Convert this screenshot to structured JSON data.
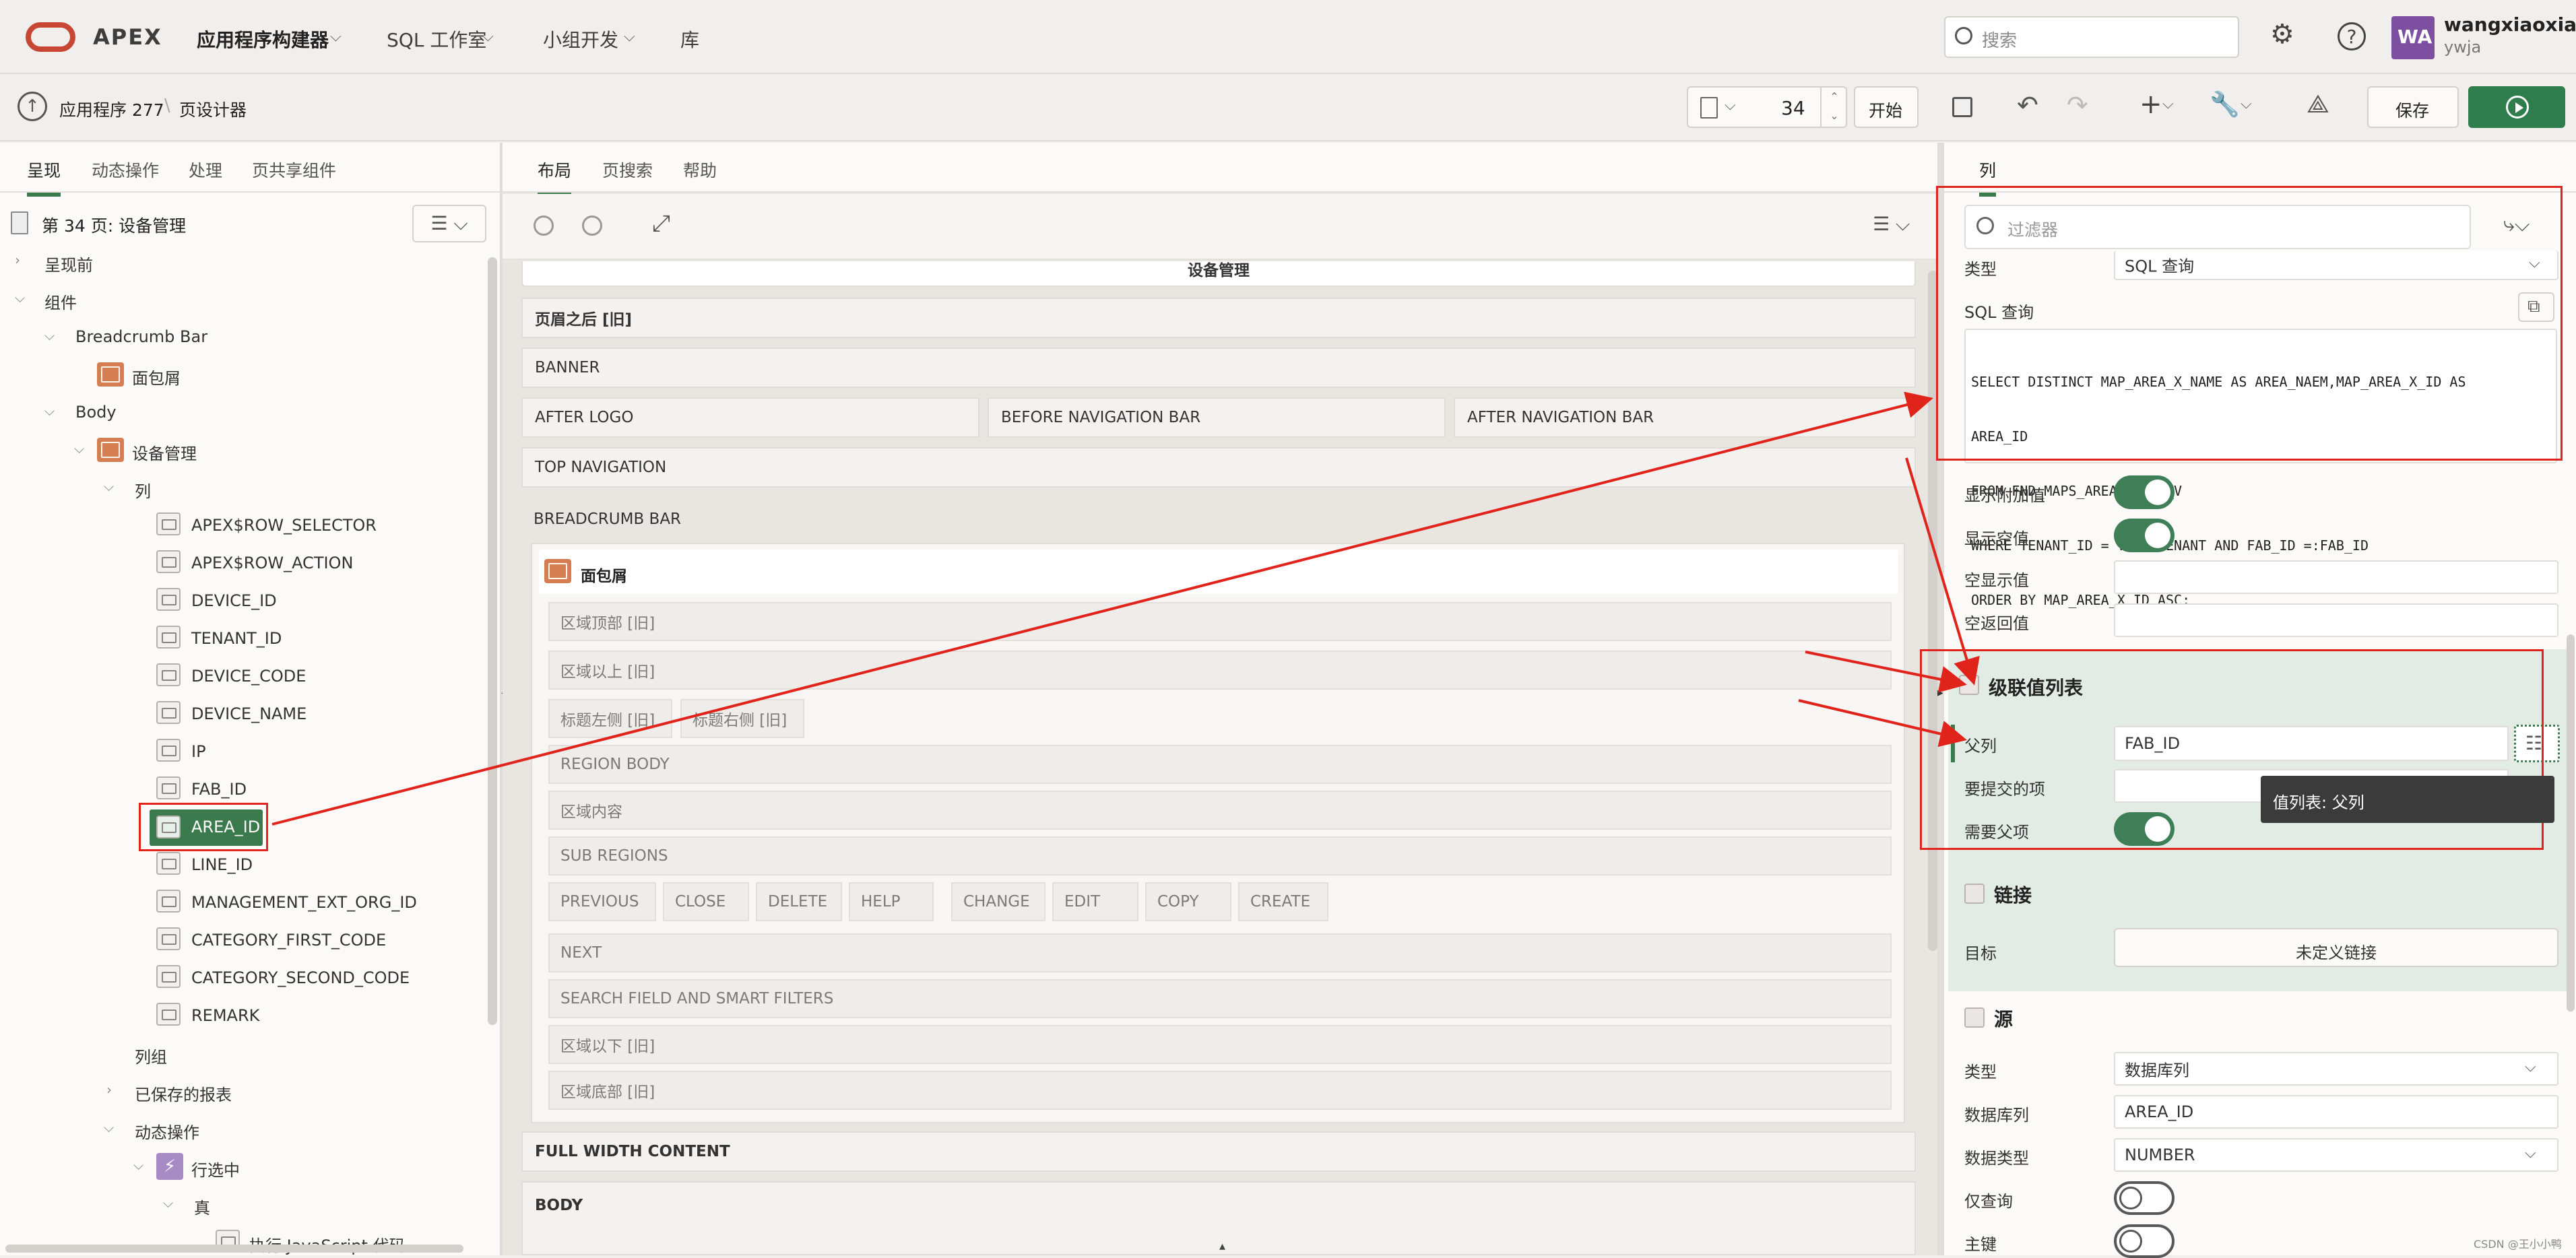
{
  "topbar": {
    "logo_text": "APEX",
    "nav": [
      "应用程序构建器",
      "SQL 工作室",
      "小组开发",
      "库"
    ],
    "search_placeholder": "搜索",
    "avatar_initials": "WA",
    "user_name": "wangxiaoxian",
    "user_workspace": "ywja"
  },
  "toolbar": {
    "breadcrumb": [
      "应用程序 277",
      "页设计器"
    ],
    "page_number": "34",
    "start_label": "开始",
    "save_label": "保存"
  },
  "left_panel": {
    "tabs": [
      "呈现",
      "动态操作",
      "处理",
      "页共享组件"
    ],
    "page_title": "第 34 页: 设备管理",
    "tree": {
      "before_header": "呈现前",
      "components": "组件",
      "breadcrumb_bar": "Breadcrumb Bar",
      "breadcrumb_region": "面包屑",
      "body": "Body",
      "region": "设备管理",
      "columns": "列",
      "column_items": [
        "APEX$ROW_SELECTOR",
        "APEX$ROW_ACTION",
        "DEVICE_ID",
        "TENANT_ID",
        "DEVICE_CODE",
        "DEVICE_NAME",
        "IP",
        "FAB_ID",
        "AREA_ID",
        "LINE_ID",
        "MANAGEMENT_EXT_ORG_ID",
        "CATEGORY_FIRST_CODE",
        "CATEGORY_SECOND_CODE",
        "REMARK"
      ],
      "column_groups": "列组",
      "saved_reports": "已保存的报表",
      "dynamic_actions": "动态操作",
      "da_event": "行选中",
      "da_true": "真",
      "da_action": "执行 JavaScript 代码"
    }
  },
  "middle_panel": {
    "tabs": [
      "布局",
      "页搜索",
      "帮助"
    ],
    "layout": {
      "top_title": "设备管理",
      "after_header": "页眉之后 [旧]",
      "banner": "BANNER",
      "after_logo": "AFTER LOGO",
      "before_nav_bar": "BEFORE NAVIGATION BAR",
      "after_nav_bar": "AFTER NAVIGATION BAR",
      "top_navigation": "TOP NAVIGATION",
      "breadcrumb_bar": "BREADCRUMB BAR",
      "breadcrumb_region": "面包屑",
      "region_top": "区域顶部 [旧]",
      "above_region": "区域以上 [旧]",
      "title_left": "标题左侧 [旧]",
      "title_right": "标题右侧 [旧]",
      "region_body": "REGION BODY",
      "region_content": "区域内容",
      "sub_regions": "SUB REGIONS",
      "buttons": [
        "PREVIOUS",
        "CLOSE",
        "DELETE",
        "HELP",
        "CHANGE",
        "EDIT",
        "COPY",
        "CREATE"
      ],
      "next": "NEXT",
      "search_field": "SEARCH FIELD AND SMART FILTERS",
      "below_region": "区域以下 [旧]",
      "region_bottom": "区域底部 [旧]",
      "full_width": "FULL WIDTH CONTENT",
      "body": "BODY"
    }
  },
  "right_panel": {
    "tab": "列",
    "filter_placeholder": "过滤器",
    "type_label": "类型",
    "type_value": "SQL 查询",
    "sql_label": "SQL 查询",
    "sql_lines": [
      "SELECT DISTINCT MAP_AREA_X_NAME AS AREA_NAEM,MAP_AREA_X_ID AS",
      "AREA_ID",
      "FROM FND_MAPS_AREAS_ASSO_V",
      "WHERE TENANT_ID = :USERTENANT AND FAB_ID =:FAB_ID",
      "ORDER BY MAP_AREA_X_ID ASC;"
    ],
    "show_extra": "显示附加值",
    "show_null": "显示空值",
    "null_display": "空显示值",
    "null_return": "空返回值",
    "cascade_section": "级联值列表",
    "parent_col_label": "父列",
    "parent_col_value": "FAB_ID",
    "items_to_submit": "要提交的项",
    "parent_required": "需要父项",
    "tooltip": "值列表: 父列",
    "link_section": "链接",
    "target_label": "目标",
    "target_value": "未定义链接",
    "source_section": "源",
    "src_type_label": "类型",
    "src_type_value": "数据库列",
    "db_col_label": "数据库列",
    "db_col_value": "AREA_ID",
    "data_type_label": "数据类型",
    "data_type_value": "NUMBER",
    "query_only": "仅查询",
    "primary_key": "主键",
    "watermark": "CSDN @王小小鸭"
  },
  "colors": {
    "accent_green": "#3b7a4d",
    "run_green": "#2f7d4d",
    "highlight_red": "#e0241b",
    "avatar_purple": "#7d4fa0"
  }
}
